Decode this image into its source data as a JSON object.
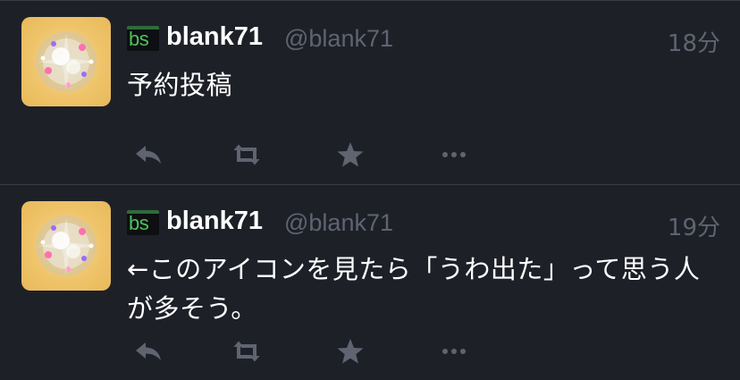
{
  "colors": {
    "background": "#1e2028",
    "divider": "#3a3d47",
    "name_text": "#ffffff",
    "muted_text": "#5f6470",
    "action_icon": "#5f6470",
    "badge_green": "#4ec25a"
  },
  "tweets": [
    {
      "client_badge": "bs",
      "display_name": "blank71",
      "screen_name": "@blank71",
      "timestamp": "18分",
      "text": "予約投稿",
      "actions": [
        "reply-icon",
        "retweet-icon",
        "star-icon",
        "more-icon"
      ]
    },
    {
      "client_badge": "bs",
      "display_name": "blank71",
      "screen_name": "@blank71",
      "timestamp": "19分",
      "text": "←このアイコンを見たら「うわ出た」って思う人が多そう。",
      "actions": [
        "reply-icon",
        "retweet-icon",
        "star-icon",
        "more-icon"
      ]
    }
  ]
}
